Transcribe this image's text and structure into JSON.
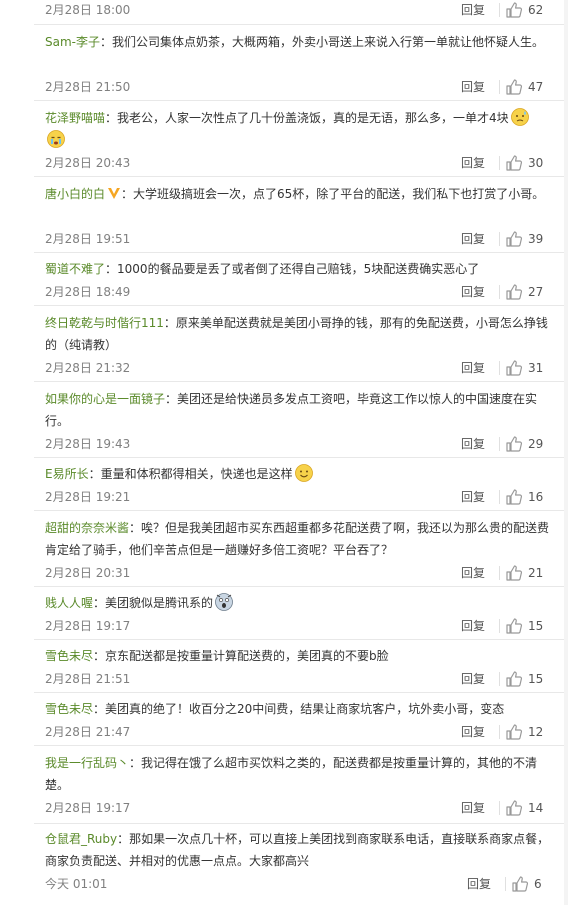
{
  "reply_label": "回复",
  "colors": {
    "username": "#5a8a2a",
    "text": "#333333",
    "meta": "#808080",
    "separator": "#e8e8e8"
  },
  "comments": [
    {
      "user": "",
      "sep": "",
      "text": "",
      "time": "2月28日 18:00",
      "likes": "62"
    },
    {
      "user": "Sam-李子",
      "sep": "：",
      "text": "我们公司集体点奶茶，大概两箱，外卖小哥送上来说入行第一单就让他怀疑人生。",
      "time": "2月28日 21:50",
      "likes": "47"
    },
    {
      "user": "花泽野喵喵",
      "sep": "：",
      "text": "我老公，人家一次性点了几十份盖浇饭，真的是无语，那么多，一单才4块",
      "time": "2月28日 20:43",
      "likes": "30",
      "emojis": [
        "sweat-face-icon",
        "crying-face-icon"
      ]
    },
    {
      "user": "唐小白的白",
      "sep": "：",
      "text": "大学班级搞班会一次，点了65杯，除了平台的配送，我们私下也打赏了小哥。",
      "time": "2月28日 19:51",
      "likes": "39",
      "badge": "v-badge-icon"
    },
    {
      "user": "蜀道不难了",
      "sep": "：",
      "text": "1000的餐品要是丢了或者倒了还得自己赔钱，5块配送费确实恶心了",
      "time": "2月28日 18:49",
      "likes": "27"
    },
    {
      "user": "终日乾乾与时偕行111",
      "sep": "：",
      "text": "原来美单配送费就是美团小哥挣的钱，那有的免配送费，小哥怎么挣钱的（纯请教）",
      "time": "2月28日 21:32",
      "likes": "31"
    },
    {
      "user": "如果你的心是一面镜子",
      "sep": "：",
      "text": "美团还是给快递员多发点工资吧，毕竟这工作以惊人的中国速度在实行。",
      "time": "2月28日 19:43",
      "likes": "29"
    },
    {
      "user": "E易所长",
      "sep": "：",
      "text": "重量和体积都得相关，快递也是这样",
      "time": "2月28日 19:21",
      "likes": "16",
      "emojis": [
        "smile-face-icon"
      ]
    },
    {
      "user": "超甜的奈奈米酱",
      "sep": "：",
      "text": "唉？但是我美团超市买东西超重都多花配送费了啊，我还以为那么贵的配送费肯定给了骑手，他们辛苦点但是一趟赚好多倍工资呢？平台吞了？",
      "time": "2月28日 20:31",
      "likes": "21"
    },
    {
      "user": "贱人人喔",
      "sep": "：",
      "text": "美团貌似是腾讯系的",
      "time": "2月28日 19:17",
      "likes": "15",
      "emojis": [
        "shocked-face-icon"
      ]
    },
    {
      "user": "雪色未尽",
      "sep": "：",
      "text": "京东配送都是按重量计算配送费的，美团真的不要b脸",
      "time": "2月28日 21:51",
      "likes": "15"
    },
    {
      "user": "雪色未尽",
      "sep": "：",
      "text": "美团真的绝了！收百分之20中间费，结果让商家坑客户，坑外卖小哥，变态",
      "time": "2月28日 21:47",
      "likes": "12"
    },
    {
      "user": "我是一行乱码丶",
      "sep": "：",
      "text": "我记得在饿了么超市买饮料之类的，配送费都是按重量计算的，其他的不清楚。",
      "time": "2月28日 19:17",
      "likes": "14"
    },
    {
      "user": "仓鼠君_Ruby",
      "sep": "：",
      "text": "那如果一次点几十杯，可以直接上美团找到商家联系电话，直接联系商家点餐，商家负责配送、并相对的优惠一点点。大家都高兴",
      "time": "今天 01:01",
      "likes": "6"
    }
  ]
}
